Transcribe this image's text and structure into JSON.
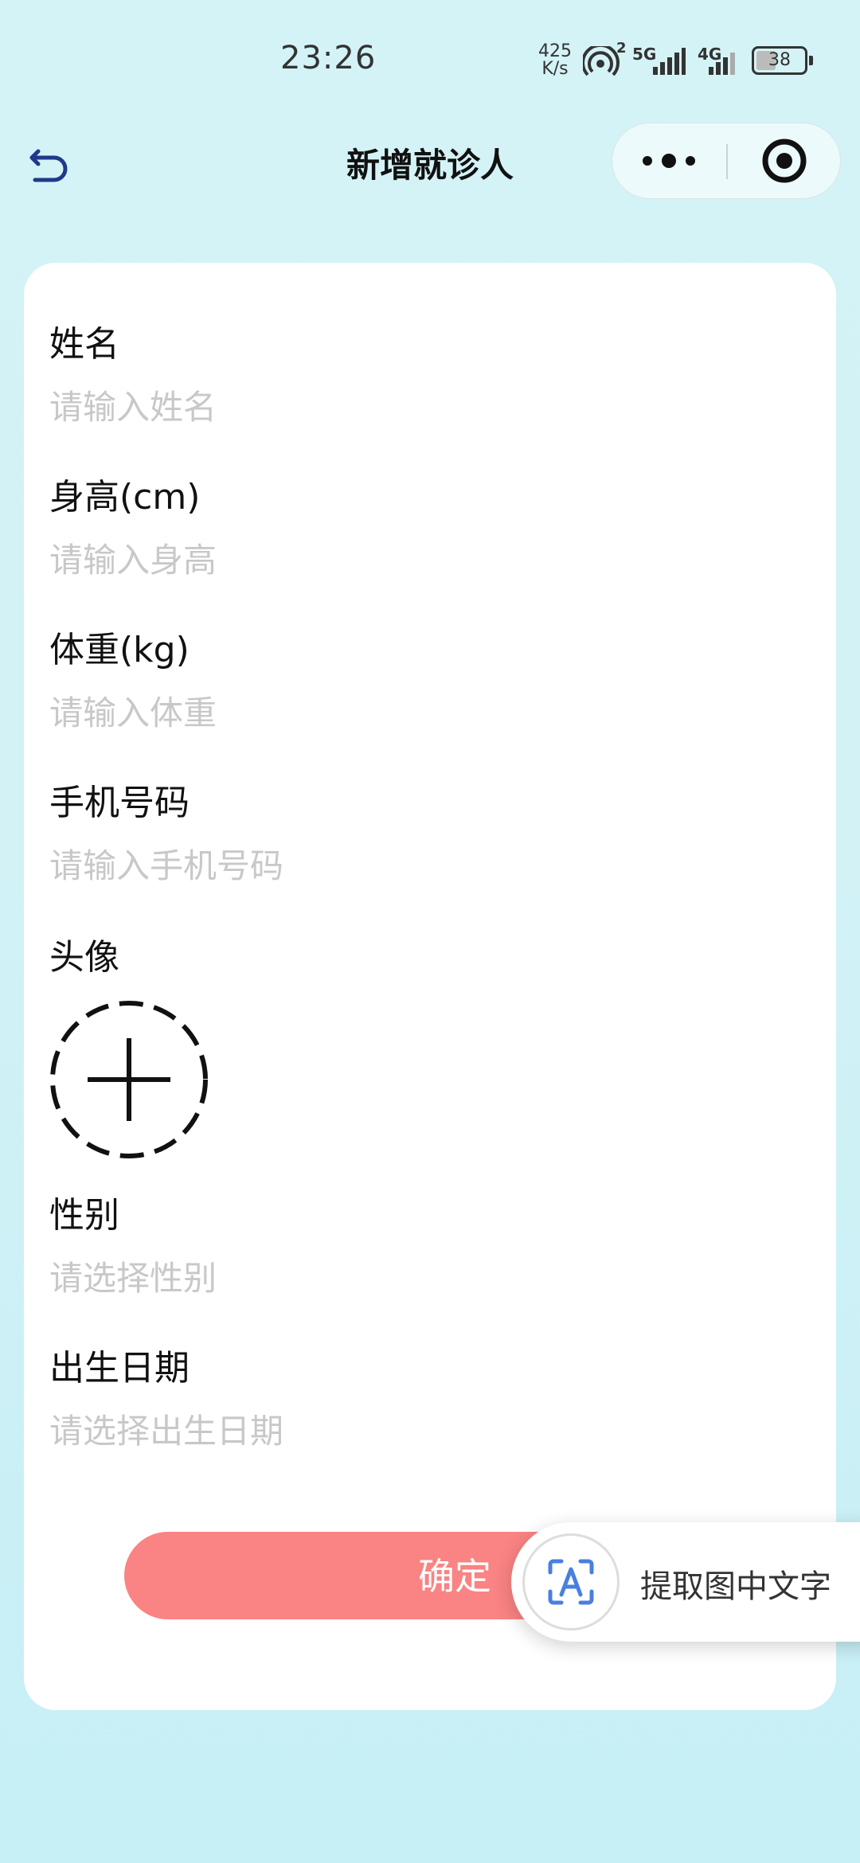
{
  "status_bar": {
    "time": "23:26",
    "net_speed_value": "425",
    "net_speed_unit": "K/s",
    "hotspot_count": "2",
    "sim1_label": "5G",
    "sim2_label": "4G",
    "battery": "38"
  },
  "nav": {
    "title": "新增就诊人",
    "back_icon": "back-arrow-icon",
    "more_icon": "more-dots-icon",
    "close_icon": "target-close-icon"
  },
  "form": {
    "name_label": "姓名",
    "name_placeholder": "请输入姓名",
    "height_label": "身高(cm)",
    "height_placeholder": "请输入身高",
    "weight_label": "体重(kg)",
    "weight_placeholder": "请输入体重",
    "phone_label": "手机号码",
    "phone_placeholder": "请输入手机号码",
    "avatar_label": "头像",
    "gender_label": "性别",
    "gender_placeholder": "请选择性别",
    "birth_label": "出生日期",
    "birth_placeholder": "请选择出生日期",
    "confirm_label": "确定"
  },
  "ocr": {
    "label": "提取图中文字",
    "icon": "text-scan-icon"
  },
  "colors": {
    "confirm_button": "#fa8383",
    "background": "#d4f3f6",
    "placeholder": "#c8c8c8",
    "ocr_icon": "#4a7fe0"
  }
}
